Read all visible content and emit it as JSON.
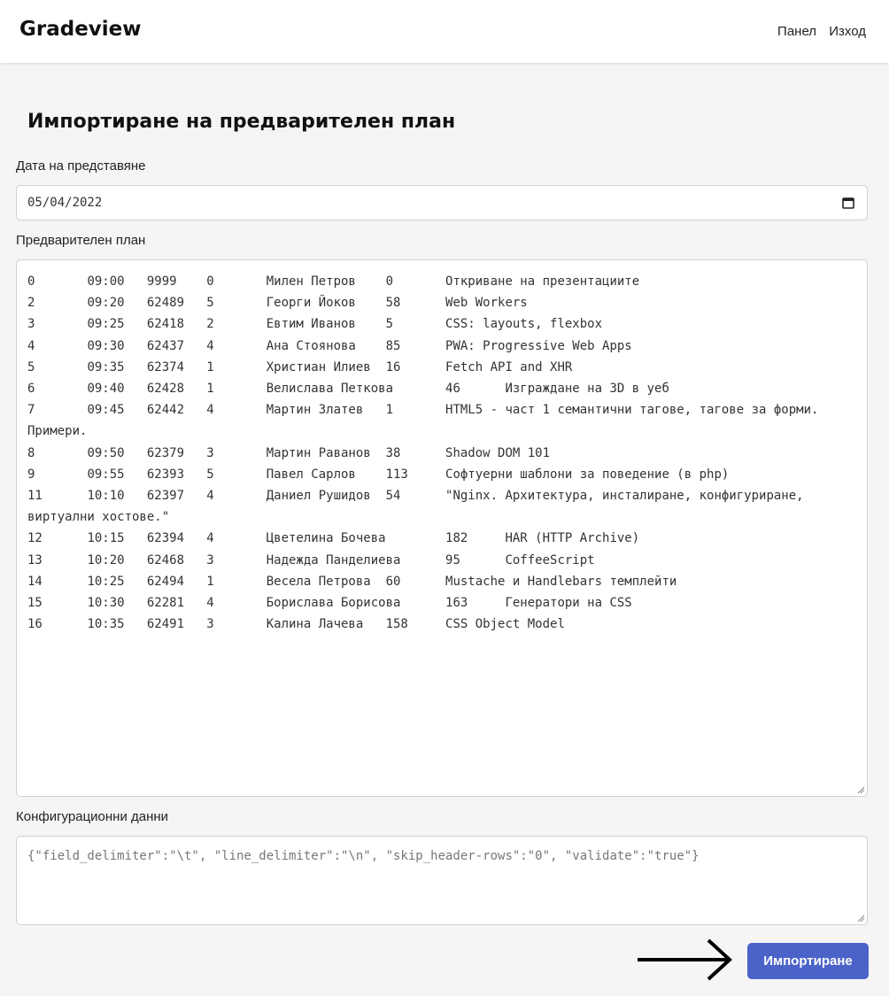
{
  "app": {
    "brand": "Gradeview"
  },
  "nav": {
    "panel": "Панел",
    "logout": "Изход"
  },
  "page": {
    "title": "Импортиране на предварителен план"
  },
  "form": {
    "date_label": "Дата на представяне",
    "date_value": "05/04/2022",
    "plan_label": "Предварителен план",
    "plan_value": "0\t09:00\t9999\t0\tМилен Петров\t0\tОткриване на презентациите\n2\t09:20\t62489\t5\tГеорги Йоков\t58\tWeb Workers\n3\t09:25\t62418\t2\tЕвтим Иванов\t5\tCSS: layouts, flexbox\n4\t09:30\t62437\t4\tАна Стоянова\t85\tPWA: Progressive Web Apps\n5\t09:35\t62374\t1\tХристиан Илиев\t16\tFetch API and XHR\n6\t09:40\t62428\t1\tВелислава Петкова\t46\tИзграждане на 3D в уеб\n7\t09:45\t62442\t4\tМартин Златев\t1\tHTML5 - част 1 семантични тагове, тагове за форми. Примери.\n8\t09:50\t62379\t3\tМартин Раванов\t38\tShadow DOM 101\n9\t09:55\t62393\t5\tПавел Сарлов\t113\tСофтуерни шаблони за поведение (в php)\n11\t10:10\t62397\t4\tДаниел Рушидов\t54\t\"Nginx. Архитектура, инсталиране, конфигуриране, виртуални хостове.\"\n12\t10:15\t62394\t4\tЦветелина Бочева\t182\tHAR (HTTP Archive)\n13\t10:20\t62468\t3\tНадежда Панделиева\t95\tCoffeeScript\n14\t10:25\t62494\t1\tВесела Петрова\t60\tMustache и Handlebars темплейти\n15\t10:30\t62281\t4\tБорислава Борисова\t163\tГенератори на CSS\n16\t10:35\t62491\t3\tКалина Лачева\t158\tCSS Object Model",
    "config_label": "Конфигурационни данни",
    "config_value": "{\"field_delimiter\":\"\\t\", \"line_delimiter\":\"\\n\", \"skip_header-rows\":\"0\", \"validate\":\"true\"}",
    "submit_label": "Импортиране"
  },
  "colors": {
    "accent": "#4b63c9",
    "background": "#f5f5f5",
    "header": "#ffffff"
  },
  "icons": {
    "date": "calendar-icon",
    "pointer": "arrow-right-icon"
  }
}
